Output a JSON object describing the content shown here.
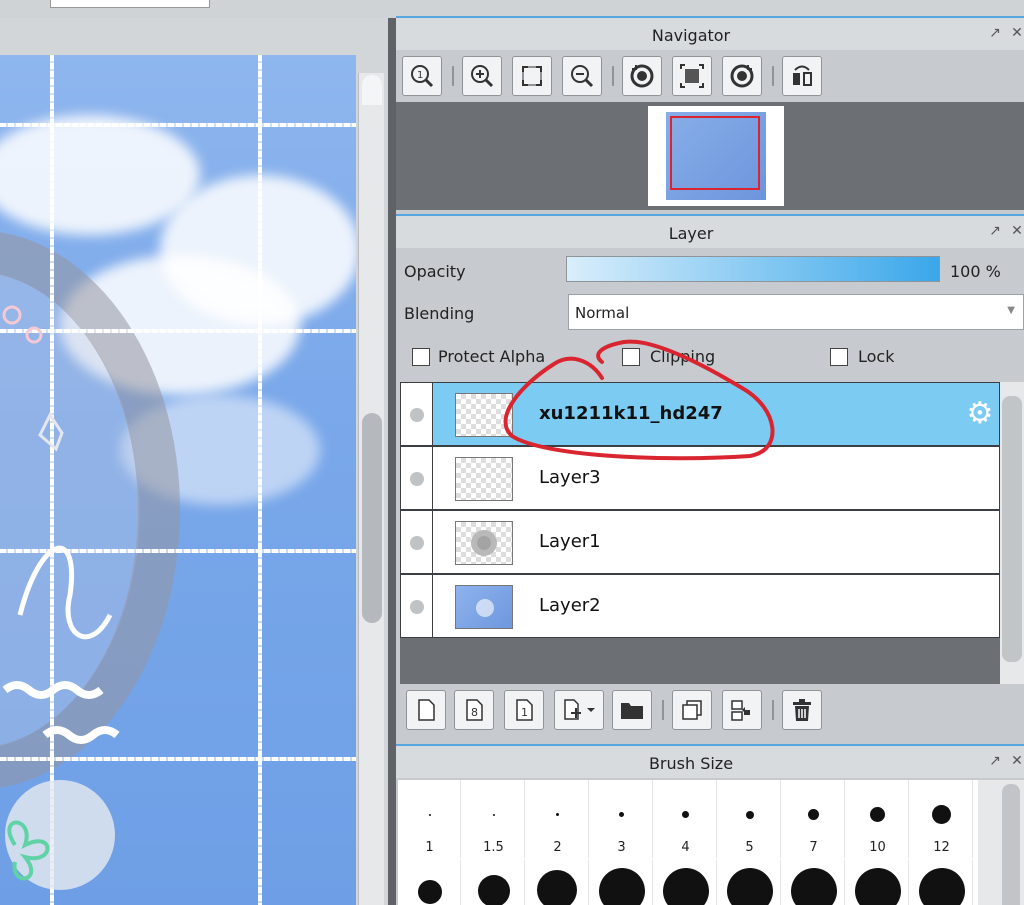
{
  "navigator": {
    "title": "Navigator",
    "tools": [
      "zoom-actual-icon",
      "zoom-in-icon",
      "fit-icon",
      "zoom-out-icon",
      "rotate-left-icon",
      "reset-view-icon",
      "rotate-right-icon",
      "flip-icon"
    ]
  },
  "layer_panel": {
    "title": "Layer",
    "opacity_label": "Opacity",
    "opacity_value": "100 %",
    "opacity_fraction": 1.0,
    "blending_label": "Blending",
    "blending_value": "Normal",
    "protect_alpha": "Protect Alpha",
    "clipping": "Clipping",
    "lock": "Lock",
    "layers": [
      {
        "name": "xu1211k11_hd247",
        "selected": true
      },
      {
        "name": "Layer3",
        "selected": false
      },
      {
        "name": "Layer1",
        "selected": false
      },
      {
        "name": "Layer2",
        "selected": false
      }
    ],
    "bottom_tools": [
      "new-layer-icon",
      "new-8bit-layer-icon",
      "new-1bit-layer-icon",
      "add-layer-dropdown-icon",
      "folder-icon",
      "duplicate-icon",
      "merge-down-icon",
      "delete-icon"
    ]
  },
  "brush_panel": {
    "title": "Brush Size",
    "sizes": [
      "1",
      "1.5",
      "2",
      "3",
      "4",
      "5",
      "7",
      "10",
      "12"
    ]
  },
  "colors": {
    "selected_layer": "#7ccbf3",
    "accent": "#58a6e0",
    "annotation": "#d9252f"
  }
}
